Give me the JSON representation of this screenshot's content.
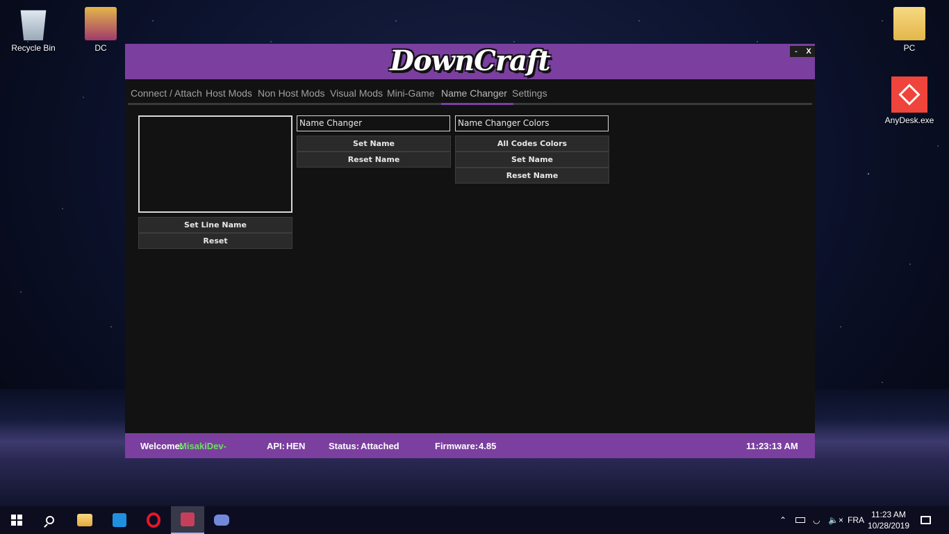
{
  "desktop": {
    "icons": [
      {
        "label": "Recycle Bin"
      },
      {
        "label": "DC"
      },
      {
        "label": "PC"
      },
      {
        "label": "AnyDesk.exe"
      }
    ]
  },
  "app": {
    "title": "DownCraft",
    "window_buttons": {
      "minimize": "-",
      "close": "X"
    },
    "tabs": [
      {
        "label": "Connect / Attach"
      },
      {
        "label": "Host Mods"
      },
      {
        "label": "Non Host Mods"
      },
      {
        "label": "Visual Mods"
      },
      {
        "label": "Mini-Game"
      },
      {
        "label": "Name Changer",
        "active": true
      },
      {
        "label": "Settings"
      }
    ],
    "left_panel": {
      "set_line_name": "Set Line Name",
      "reset": "Reset"
    },
    "name_changer": {
      "input_value": "Name Changer",
      "set_name": "Set Name",
      "reset_name": "Reset Name"
    },
    "name_changer_colors": {
      "input_value": "Name Changer Colors",
      "all_codes_colors": "All Codes Colors",
      "set_name": "Set Name",
      "reset_name": "Reset Name"
    },
    "status": {
      "welcome_label": "Welcome:",
      "welcome_user": "MisakiDev-",
      "api_label": "API:",
      "api_value": "HEN",
      "status_label": "Status:",
      "status_value": "Attached",
      "firmware_label": "Firmware:",
      "firmware_value": "4.85",
      "time": "11:23:13 AM"
    },
    "colors": {
      "accent": "#7b3fa0",
      "background": "#121212",
      "welcome_user": "#6ae05a"
    }
  },
  "taskbar": {
    "language": "FRA",
    "time": "11:23 AM",
    "date": "10/28/2019"
  }
}
